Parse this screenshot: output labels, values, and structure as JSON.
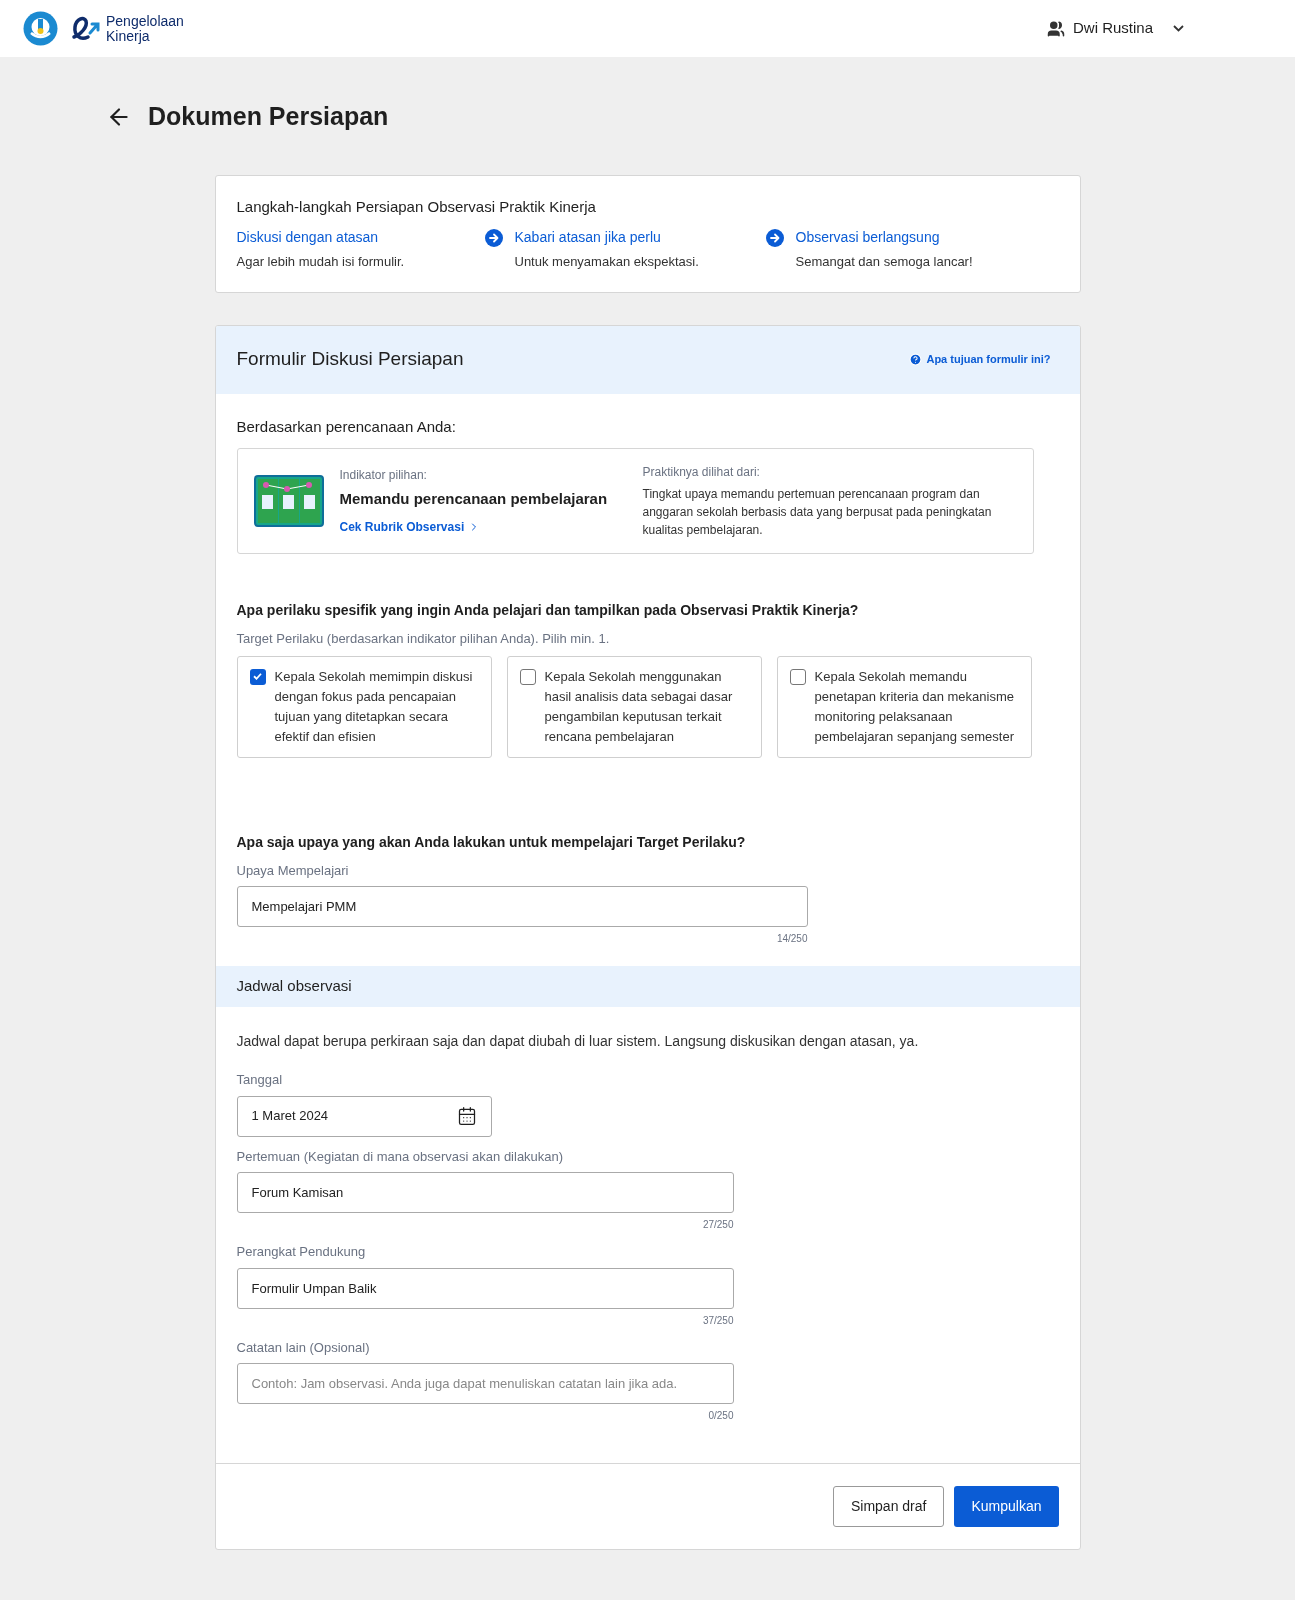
{
  "header": {
    "logo_text": [
      "Pengelolaan",
      "Kinerja"
    ],
    "user": "Dwi Rustina"
  },
  "page_title": "Dokumen Persiapan",
  "steps": {
    "title": "Langkah-langkah Persiapan Observasi Praktik Kinerja",
    "items": [
      {
        "title": "Diskusi dengan atasan",
        "subtitle": "Agar lebih mudah isi formulir."
      },
      {
        "title": "Kabari atasan jika perlu",
        "subtitle": "Untuk menyamakan ekspektasi."
      },
      {
        "title": "Observasi berlangsung",
        "subtitle": "Semangat dan semoga lancar!"
      }
    ]
  },
  "form": {
    "title": "Formulir Diskusi Persiapan",
    "help_link": "Apa tujuan formulir ini?",
    "basis_heading": "Berdasarkan perencanaan Anda:",
    "indicator": {
      "label": "Indikator pilihan:",
      "value": "Memandu perencanaan pembelajaran",
      "link": "Cek Rubrik Observasi",
      "practice_label": "Praktiknya dilihat dari:",
      "practice_text": "Tingkat upaya memandu pertemuan perencanaan program dan anggaran sekolah berbasis data yang berpusat pada peningkatan kualitas pembelajaran."
    },
    "behavior_question": "Apa perilaku spesifik yang ingin Anda pelajari dan tampilkan pada Observasi Praktik Kinerja?",
    "behavior_hint": "Target Perilaku (berdasarkan indikator pilihan Anda). Pilih min. 1.",
    "behaviors": [
      {
        "text": "Kepala Sekolah memimpin diskusi dengan fokus pada pencapaian tujuan yang ditetapkan secara efektif dan efisien",
        "checked": true
      },
      {
        "text": "Kepala Sekolah menggunakan hasil analisis data sebagai dasar pengambilan keputusan terkait rencana pembelajaran",
        "checked": false
      },
      {
        "text": "Kepala Sekolah memandu penetapan kriteria dan mekanisme monitoring pelaksanaan pembelajaran sepanjang semester",
        "checked": false
      }
    ],
    "effort_question": "Apa saja upaya yang akan Anda lakukan untuk mempelajari Target Perilaku?",
    "effort_field": {
      "label": "Upaya Mempelajari",
      "value": "Mempelajari PMM",
      "counter": "14/250"
    },
    "schedule": {
      "title": "Jadwal observasi",
      "note": "Jadwal dapat berupa perkiraan saja dan dapat diubah di luar sistem. Langsung diskusikan dengan atasan, ya.",
      "fields": [
        {
          "kind": "date",
          "label": "Tanggal",
          "value": "1 Maret 2024"
        },
        {
          "kind": "text",
          "label": "Pertemuan (Kegiatan di mana observasi akan dilakukan)",
          "value": "Forum Kamisan",
          "counter": "27/250"
        },
        {
          "kind": "text",
          "label": "Perangkat Pendukung",
          "value": "Formulir Umpan Balik",
          "counter": "37/250"
        },
        {
          "kind": "text",
          "label": "Catatan lain (Opsional)",
          "placeholder": "Contoh: Jam observasi. Anda juga dapat menuliskan catatan lain jika ada.",
          "counter": "0/250"
        }
      ]
    },
    "buttons": {
      "secondary": "Simpan draf",
      "primary": "Kumpulkan"
    }
  }
}
